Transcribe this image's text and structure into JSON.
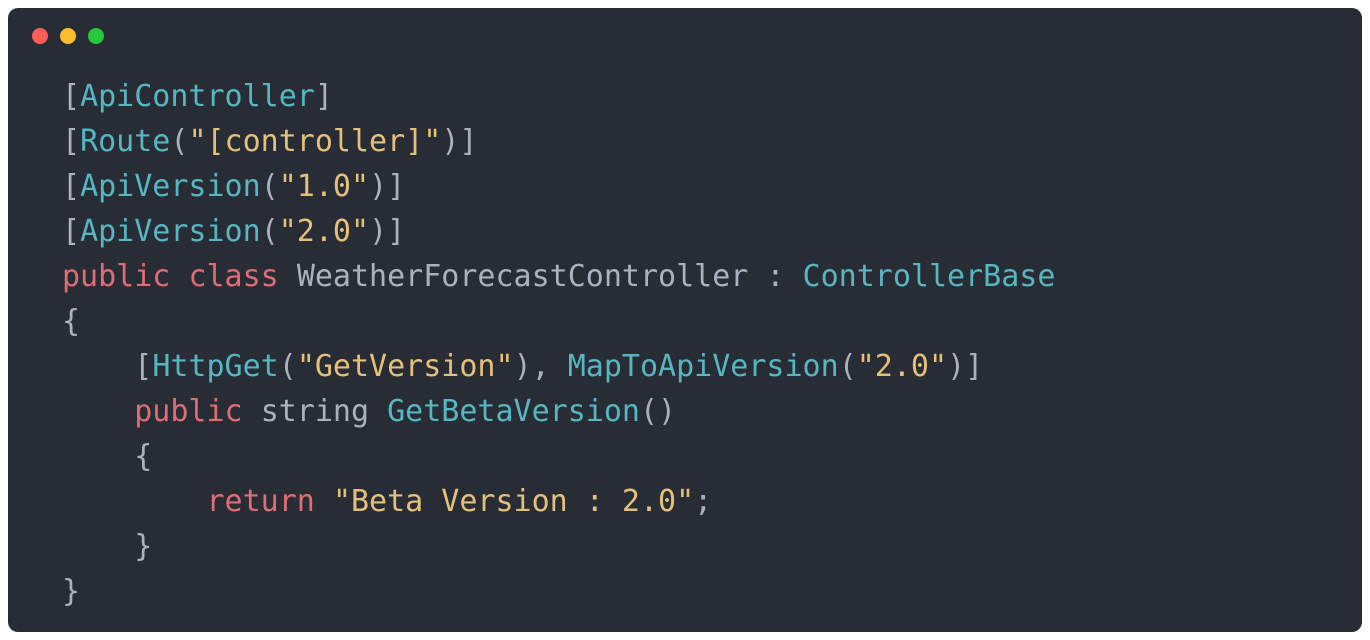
{
  "colors": {
    "background": "#282c34",
    "red": "#ff5f56",
    "yellow": "#ffbd2e",
    "green": "#27c93f",
    "type": "#56b6c2",
    "keyword": "#e06c75",
    "string": "#e5c07b",
    "default": "#abb2bf"
  },
  "code": {
    "line1": {
      "bracket_open": "[",
      "attr": "ApiController",
      "bracket_close": "]"
    },
    "line2": {
      "bracket_open": "[",
      "attr": "Route",
      "paren_open": "(",
      "str": "\"[controller]\"",
      "paren_close": ")",
      "bracket_close": "]"
    },
    "line3": {
      "bracket_open": "[",
      "attr": "ApiVersion",
      "paren_open": "(",
      "str": "\"1.0\"",
      "paren_close": ")",
      "bracket_close": "]"
    },
    "line4": {
      "bracket_open": "[",
      "attr": "ApiVersion",
      "paren_open": "(",
      "str": "\"2.0\"",
      "paren_close": ")",
      "bracket_close": "]"
    },
    "line5": {
      "kw_public": "public",
      "sp1": " ",
      "kw_class": "class",
      "sp2": " ",
      "classname": "WeatherForecastController",
      "colon": " : ",
      "base": "ControllerBase"
    },
    "line6": {
      "brace": "{"
    },
    "line7": {
      "indent": "    ",
      "bracket_open": "[",
      "attr1": "HttpGet",
      "paren_open1": "(",
      "str1": "\"GetVersion\"",
      "paren_close1": ")",
      "comma": ", ",
      "attr2": "MapToApiVersion",
      "paren_open2": "(",
      "str2": "\"2.0\"",
      "paren_close2": ")",
      "bracket_close": "]"
    },
    "line8": {
      "indent": "    ",
      "kw_public": "public",
      "sp1": " ",
      "type": "string",
      "sp2": " ",
      "method": "GetBetaVersion",
      "parens": "()"
    },
    "line9": {
      "indent": "    ",
      "brace": "{"
    },
    "line10": {
      "indent": "        ",
      "kw_return": "return",
      "sp": " ",
      "str": "\"Beta Version : 2.0\"",
      "semi": ";"
    },
    "line11": {
      "indent": "    ",
      "brace": "}"
    },
    "line12": {
      "brace": "}"
    }
  }
}
